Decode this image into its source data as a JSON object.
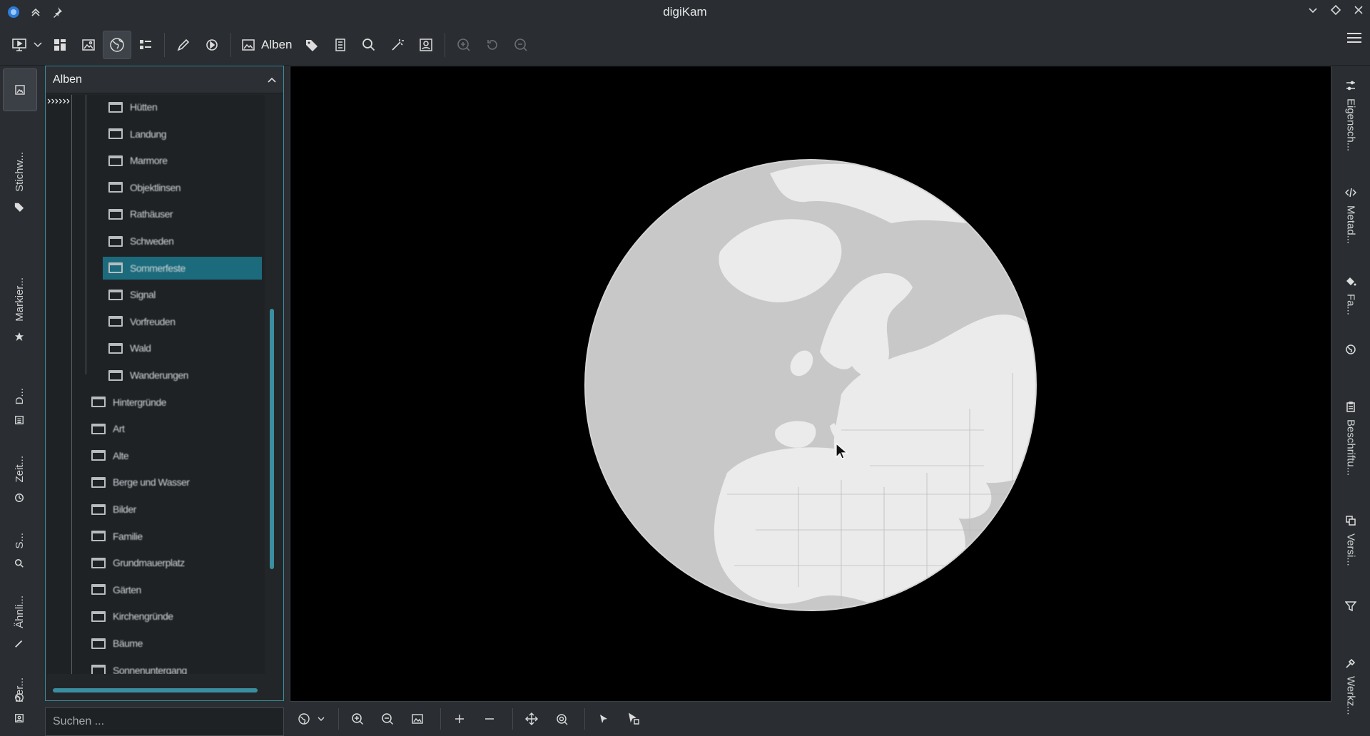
{
  "window": {
    "title": "digiKam"
  },
  "toolbar": {
    "albums_label": "Alben"
  },
  "left_tabs": [
    {
      "label": "Stichw...",
      "icon": "tag-icon"
    },
    {
      "label": "Markier...",
      "icon": "star-icon"
    },
    {
      "label": "D...",
      "icon": "calendar-icon"
    },
    {
      "label": "Zeit...",
      "icon": "clock-icon"
    },
    {
      "label": "S...",
      "icon": "search-icon"
    },
    {
      "label": "Ähnli...",
      "icon": "wand-icon"
    },
    {
      "label": "Per...",
      "icon": "person-icon"
    }
  ],
  "albums_panel": {
    "title": "Alben",
    "items": [
      "Hütten",
      "Landung",
      "Marmore",
      "Objektlinsen",
      "Rathäuser",
      "Schweden",
      "Sommerfeste",
      "Signal",
      "Vorfreuden",
      "Wald",
      "Wanderungen",
      "Hintergründe",
      "Art",
      "Alte",
      "Berge und Wasser",
      "Bilder",
      "Familie",
      "Grundmauerplatz",
      "Gärten",
      "Kirchengründe",
      "Bäume",
      "Sonnenuntergang"
    ]
  },
  "search": {
    "placeholder": "Suchen ..."
  },
  "right_tabs": [
    {
      "label": "Eigensch...",
      "icon": "sliders-icon"
    },
    {
      "label": "Metad...",
      "icon": "code-icon"
    },
    {
      "label": "Fa...",
      "icon": "paint-bucket-icon"
    },
    {
      "label": "",
      "icon": "globe-icon"
    },
    {
      "label": "Beschriftu...",
      "icon": "clipboard-icon"
    },
    {
      "label": "Versi...",
      "icon": "versions-icon"
    },
    {
      "label": "",
      "icon": "filter-icon"
    },
    {
      "label": "Werkz...",
      "icon": "tool-icon"
    }
  ]
}
